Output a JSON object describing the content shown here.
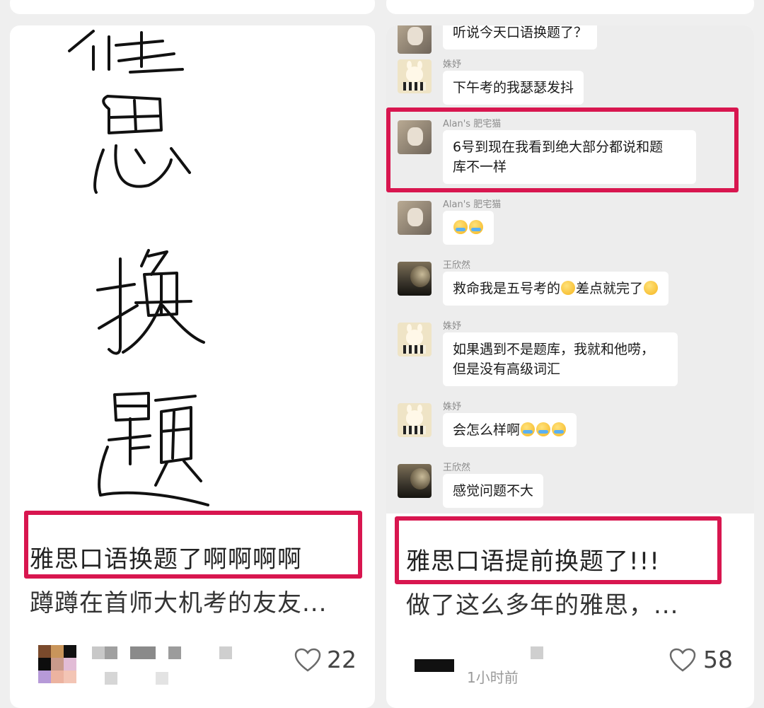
{
  "left_card": {
    "cover_handwriting_chars": [
      "雅",
      "思",
      "换",
      "题"
    ],
    "title_line1": "雅思口语换题了啊啊啊啊",
    "title_line2": "蹲蹲在首师大机考的友友...",
    "likes": "22",
    "highlight_color": "#d8164f"
  },
  "right_card": {
    "chat": [
      {
        "name": "",
        "text": "听说今天口语换题了？",
        "avatar": "cat"
      },
      {
        "name": "姝妤",
        "text": "下午考的我瑟瑟发抖",
        "avatar": "bunny"
      },
      {
        "name": "Alan's 肥宅猫",
        "text_line1": "6号到现在我看到绝大部分都说和题",
        "text_line2": "库不一样",
        "avatar": "cat"
      },
      {
        "name": "Alan's 肥宅猫",
        "text": "",
        "avatar": "cat"
      },
      {
        "name": "王欣然",
        "text_a": "救命我是五号考的",
        "text_b": "差点就完了",
        "avatar": "moon"
      },
      {
        "name": "姝妤",
        "text_line1": "如果遇到不是题库，我就和他唠，",
        "text_line2": "但是没有高级词汇",
        "avatar": "bunny"
      },
      {
        "name": "姝妤",
        "text": "会怎么样啊",
        "avatar": "bunny"
      },
      {
        "name": "王欣然",
        "text": "感觉问题不大",
        "avatar": "moon"
      }
    ],
    "title_line1": "雅思口语提前换题了!!!",
    "title_line2": "做了这么多年的雅思，...",
    "time_ago": "1小时前",
    "likes": "58"
  },
  "colors": {
    "accent": "#d8164f",
    "page_bg": "#efefef",
    "chat_bg": "#ededed"
  }
}
